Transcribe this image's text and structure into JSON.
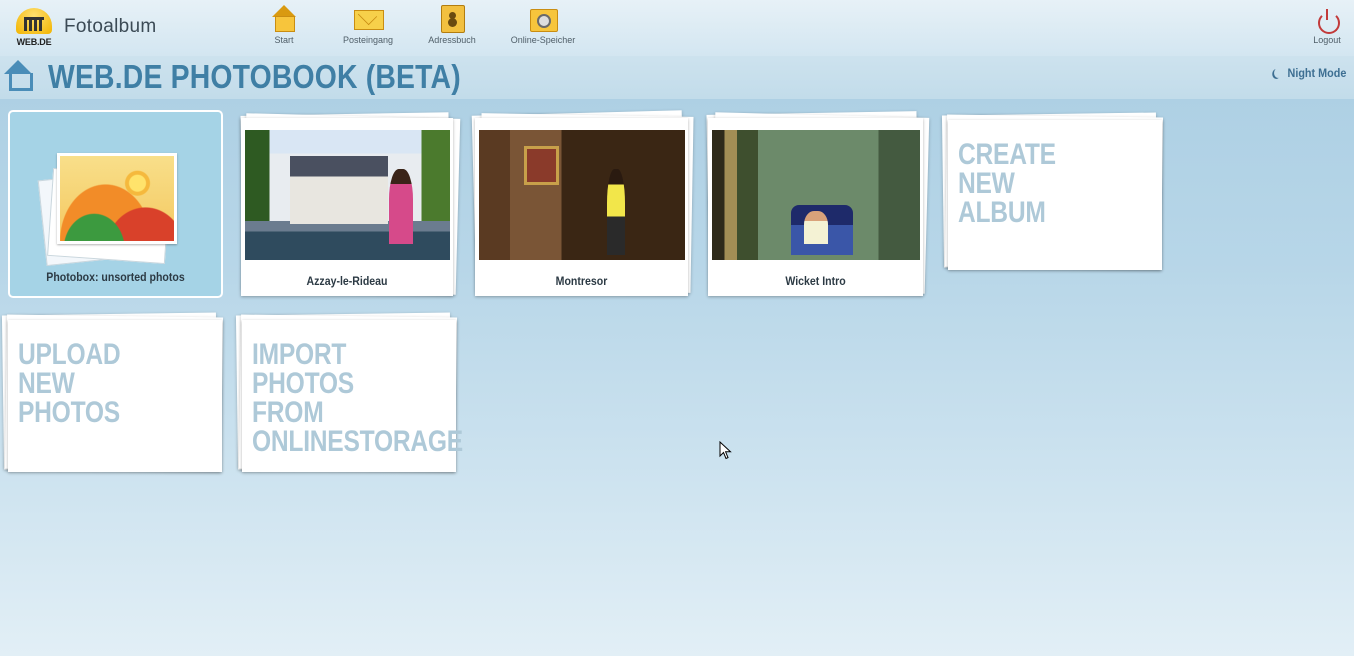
{
  "header": {
    "brand_text": "WEB.DE",
    "app_title": "Fotoalbum",
    "nav": [
      {
        "label": "Start",
        "icon": "home-icon"
      },
      {
        "label": "Posteingang",
        "icon": "mail-icon"
      },
      {
        "label": "Adressbuch",
        "icon": "address-book-icon"
      },
      {
        "label": "Online-Speicher",
        "icon": "online-storage-icon"
      }
    ],
    "logout_label": "Logout",
    "logout_icon": "power-icon"
  },
  "titlebar": {
    "title": "WEB.DE PHOTOBOOK (BETA)",
    "night_mode_label": "Night Mode"
  },
  "albums": [
    {
      "label": "Photobox: unsorted photos",
      "kind": "photobox"
    },
    {
      "label": "Azzay-le-Rideau",
      "kind": "album"
    },
    {
      "label": "Montresor",
      "kind": "album"
    },
    {
      "label": "Wicket Intro",
      "kind": "album"
    }
  ],
  "actions": [
    {
      "label": "CREATE NEW\nALBUM"
    },
    {
      "label": "UPLOAD NEW\nPHOTOS"
    },
    {
      "label": "IMPORT PHOTOS\nFROM\nONLINESTORAGE"
    }
  ],
  "colors": {
    "accent": "#3f7fa5",
    "photobox_bg": "#a5d3e6",
    "action_text": "#aec9d8",
    "logout": "#c23a3a"
  }
}
